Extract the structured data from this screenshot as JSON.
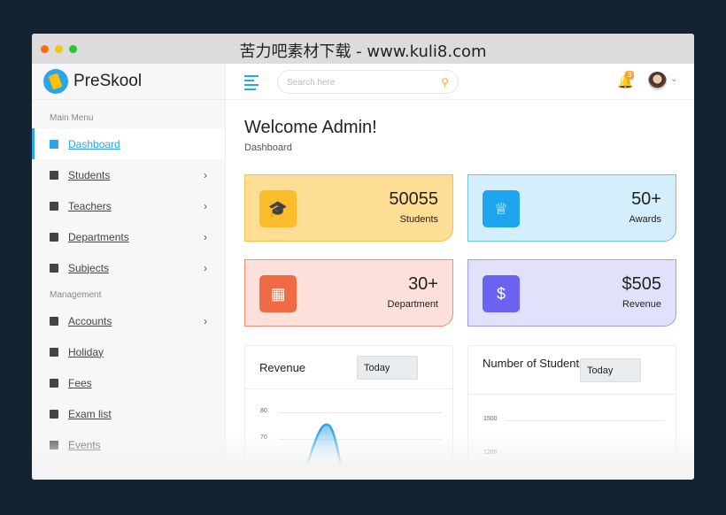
{
  "window": {
    "title": "苦力吧素材下载 - www.kuli8.com"
  },
  "brand": {
    "name": "PreSkool"
  },
  "sidebar": {
    "main_menu_title": "Main Menu",
    "items": [
      {
        "label": "Dashboard",
        "icon": "grid-icon",
        "active": true,
        "chevron": false
      },
      {
        "label": "Students",
        "icon": "graduation-cap-icon",
        "chevron": true
      },
      {
        "label": "Teachers",
        "icon": "chalkboard-teacher-icon",
        "chevron": true
      },
      {
        "label": "Departments",
        "icon": "building-icon",
        "chevron": true
      },
      {
        "label": "Subjects",
        "icon": "book-reader-icon",
        "chevron": true
      }
    ],
    "management_title": "Management",
    "mgmt_items": [
      {
        "label": "Accounts",
        "icon": "file-invoice-icon",
        "chevron": true
      },
      {
        "label": "Holiday",
        "icon": "holiday-icon",
        "chevron": false
      },
      {
        "label": "Fees",
        "icon": "money-icon",
        "chevron": false
      },
      {
        "label": "Exam list",
        "icon": "clipboard-icon",
        "chevron": false
      },
      {
        "label": "Events",
        "icon": "calendar-icon",
        "chevron": false
      }
    ]
  },
  "header": {
    "search_placeholder": "Search here",
    "notifications": "3"
  },
  "page": {
    "title": "Welcome Admin!",
    "breadcrumb": "Dashboard"
  },
  "stats": [
    {
      "value": "50055",
      "label": "Students",
      "bg": "#fedd95",
      "border": "#f7c24a",
      "icon_bg": "#fbbc2e"
    },
    {
      "value": "50+",
      "label": "Awards",
      "bg": "#d4eefb",
      "border": "#6cc2ec",
      "icon_bg": "#1ea5ed"
    },
    {
      "value": "30+",
      "label": "Department",
      "bg": "#fde0d9",
      "border": "#ef8e73",
      "icon_bg": "#f06b43"
    },
    {
      "value": "$505",
      "label": "Revenue",
      "bg": "#e2e1fc",
      "border": "#a09af0",
      "icon_bg": "#6b62f0"
    }
  ],
  "panels": [
    {
      "title": "Revenue",
      "select": "Today",
      "ticks": [
        "80",
        "70"
      ]
    },
    {
      "title": "Number of Students",
      "select": "Today",
      "ticks": [
        "1500",
        "1200"
      ]
    }
  ]
}
